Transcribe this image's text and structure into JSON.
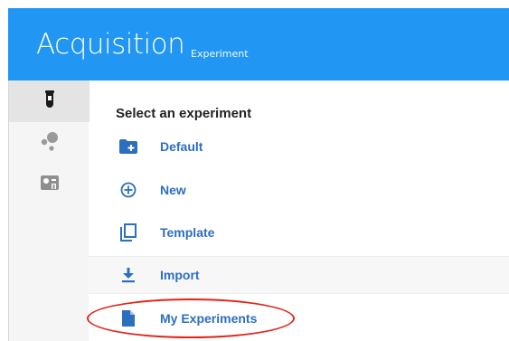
{
  "header": {
    "title": "Acquisition",
    "subtitle": "Experiment",
    "background": "#2196f3"
  },
  "sidebar": {
    "items": [
      {
        "icon": "test-tube-icon",
        "active": true
      },
      {
        "icon": "molecules-icon",
        "active": false
      },
      {
        "icon": "instrument-icon",
        "active": false
      }
    ]
  },
  "main": {
    "section_title": "Select an experiment",
    "items": [
      {
        "label": "Default",
        "icon": "new-folder-icon"
      },
      {
        "label": "New",
        "icon": "add-circle-icon"
      },
      {
        "label": "Template",
        "icon": "copy-icon"
      },
      {
        "label": "Import",
        "icon": "download-icon"
      },
      {
        "label": "My Experiments",
        "icon": "document-icon"
      }
    ],
    "accent": "#2c6fbe"
  },
  "annotation": {
    "color": "#e0241b",
    "target": "My Experiments"
  }
}
